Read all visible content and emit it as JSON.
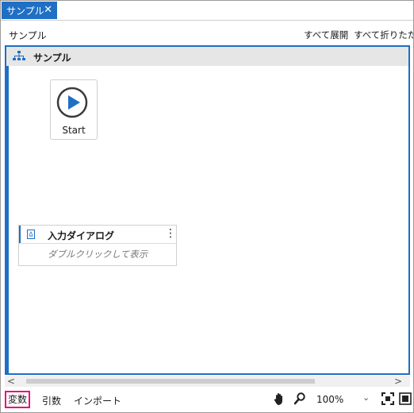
{
  "tab": {
    "label": "サンプル",
    "close": "✕"
  },
  "header": {
    "breadcrumb": "サンプル",
    "expand_all": "すべて展開",
    "collapse_all": "すべて折りたたむ"
  },
  "sequence": {
    "title": "サンプル",
    "icon": "sequence-hierarchy-icon"
  },
  "start_node": {
    "label": "Start",
    "icon": "play-icon"
  },
  "activity": {
    "title": "入力ダイアログ",
    "icon": "document-icon",
    "menu": "⋮",
    "hint": "ダブルクリックして表示"
  },
  "scrollbar": {
    "left": "<",
    "right": ">"
  },
  "bottom": {
    "variables": "変数",
    "arguments": "引数",
    "imports": "インポート",
    "zoom": "100%",
    "zoom_caret": "⌄",
    "icons": [
      "hand-pan-icon",
      "zoom-icon",
      "fit-to-screen-icon",
      "overview-icon"
    ]
  },
  "colors": {
    "accent": "#1f6fc4",
    "highlight": "#e3177d",
    "seq_header_bg": "#e6e6e6"
  }
}
